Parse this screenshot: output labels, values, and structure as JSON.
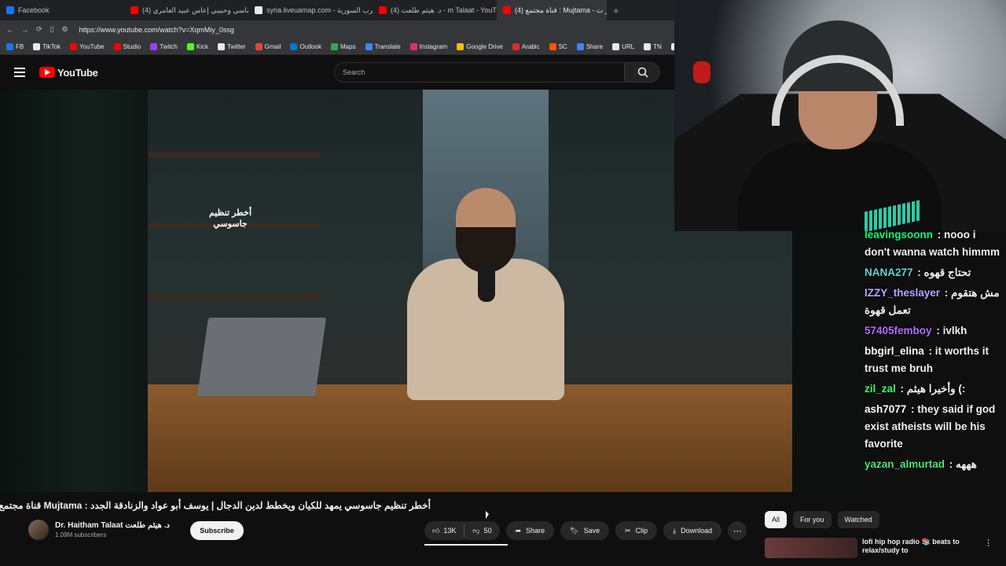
{
  "browser": {
    "tabs": [
      {
        "label": "Facebook",
        "color": "#1877f2"
      },
      {
        "label": "(4) إماسي وحبيبي إعاس عبيد العامري",
        "color": "#ff0000"
      },
      {
        "label": "syria.liveuamap.com - الحرب السورية",
        "color": "#e8eaed"
      },
      {
        "label": "(4) د. هيثم طلعت - m Talaat - YouTube",
        "color": "#ff0000"
      },
      {
        "label": "(4) قناة مجتمع : Mujtama - أخطر ت",
        "color": "#ff0000"
      }
    ],
    "new_tab": "+",
    "url": "https://www.youtube.com/watch?v=XqmMiy_0ssg",
    "bookmarks": [
      {
        "label": "FB",
        "color": "#1877f2"
      },
      {
        "label": "TikTok",
        "color": "#e8eaed"
      },
      {
        "label": "YouTube",
        "color": "#ff0000"
      },
      {
        "label": "Studio",
        "color": "#ff0000"
      },
      {
        "label": "Twitch",
        "color": "#9146ff"
      },
      {
        "label": "Kick",
        "color": "#53fc18"
      },
      {
        "label": "Twitter",
        "color": "#e8eaed"
      },
      {
        "label": "Gmail",
        "color": "#ea4335"
      },
      {
        "label": "Outlook",
        "color": "#0078d4"
      },
      {
        "label": "Maps",
        "color": "#34a853"
      },
      {
        "label": "Translate",
        "color": "#4285f4"
      },
      {
        "label": "Instagram",
        "color": "#e1306c"
      },
      {
        "label": "Google Drive",
        "color": "#fbbc04"
      },
      {
        "label": "Arabic",
        "color": "#d93025"
      },
      {
        "label": "SC",
        "color": "#ff5500"
      },
      {
        "label": "Share",
        "color": "#4285f4"
      },
      {
        "label": "URL",
        "color": "#e8eaed"
      },
      {
        "label": "TN",
        "color": "#e8eaed"
      },
      {
        "label": "Ch",
        "color": "#e8eaed"
      }
    ]
  },
  "youtube": {
    "logo": "YouTube",
    "search_placeholder": "Search",
    "video_overlay_text": "أخطر تنظيم جاسوسي",
    "title": "أخطر تنظيم جاسوسي يمهد للكيان ويخطط لدين الدجال | يوسف أبو عواد والزنادقة الجدد : Mujtama قناة مجتمع",
    "channel_name": "Dr. Haitham Talaat د. هيثم طلعت",
    "subscribers": "1.09M subscribers",
    "subscribe": "Subscribe",
    "likes": "13K",
    "dislikes": "50",
    "share": "Share",
    "save": "Save",
    "clip": "Clip",
    "download": "Download",
    "more": "⋯",
    "chips": [
      "All",
      "For you",
      "Watched"
    ],
    "recommendation_title": "lofi hip hop radio 📚 beats to relax/study to"
  },
  "chat": [
    {
      "user": "leavingsoonn",
      "text": "nooo i don't wanna watch himmm",
      "color": "#00ff7f"
    },
    {
      "user": "NANA277",
      "text": "تحتاج قهوه",
      "color": "#5fd3d3"
    },
    {
      "user": "IZZY_theslayer",
      "text": "مش هتقوم تعمل قهوة",
      "color": "#b4a7ff"
    },
    {
      "user": "57405femboy",
      "text": "ivlkh",
      "color": "#b46cff"
    },
    {
      "user": "bbgirl_elina",
      "text": "it worths it trust me bruh",
      "color": "#ffffff"
    },
    {
      "user": "zil_zal",
      "text": "وأخيرا هيثم (:",
      "color": "#3cff6b"
    },
    {
      "user": "ash7077",
      "text": "they said if god exist atheists will be his favorite",
      "color": "#ffffff"
    },
    {
      "user": "yazan_almurtad",
      "text": "هههه",
      "color": "#4be37a"
    }
  ]
}
